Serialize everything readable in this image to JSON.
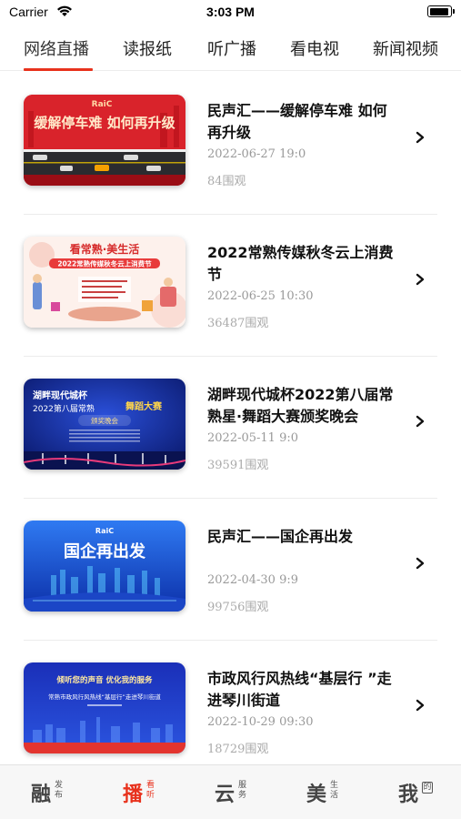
{
  "status_bar": {
    "carrier": "Carrier",
    "time": "3:03 PM"
  },
  "top_tabs": [
    {
      "label": "网络直播",
      "active": true
    },
    {
      "label": "读报纸",
      "active": false
    },
    {
      "label": "听广播",
      "active": false
    },
    {
      "label": "看电视",
      "active": false
    },
    {
      "label": "新闻视频",
      "active": false
    }
  ],
  "items": [
    {
      "title": "民声汇——缓解停车难 如何再升级",
      "date": "2022-06-27 19:0",
      "views": "84围观",
      "thumb_text": "缓解停车难  如何再升级",
      "thumb_logo": "RaiC"
    },
    {
      "title": "2022常熟传媒秋冬云上消费节",
      "date": "2022-06-25 10:30",
      "views": "36487围观",
      "thumb_text": "看常熟·美生活",
      "thumb_sub": "2022常熟传媒秋冬云上消费节"
    },
    {
      "title": "湖畔现代城杯2022第八届常熟星·舞蹈大赛颁奖晚会",
      "date": "2022-05-11 9:0",
      "views": "39591围观",
      "thumb_text": "湖畔现代城杯",
      "thumb_sub": "2022第八届常熟",
      "thumb_extra": "舞蹈大赛",
      "thumb_tag": "颁奖晚会"
    },
    {
      "title": "民声汇——国企再出发",
      "date": "2022-04-30 9:9",
      "views": "99756围观",
      "thumb_text": "国企再出发",
      "thumb_logo": "RaiC"
    },
    {
      "title": "市政风行风热线“基层行 ”走进琴川街道",
      "date": "2022-10-29 09:30",
      "views": "18729围观",
      "thumb_text": "倾听您的声音  优化我的服务",
      "thumb_sub": "常熟市政风行风热线“基层行”走进琴川街道"
    }
  ],
  "bottom_nav": [
    {
      "big": "融",
      "small": "发布",
      "active": false
    },
    {
      "big": "播",
      "small": "看听",
      "active": true
    },
    {
      "big": "云",
      "small": "服务",
      "active": false
    },
    {
      "big": "美",
      "small": "生活",
      "active": false
    },
    {
      "big": "我",
      "small": "的",
      "active": false
    }
  ],
  "colors": {
    "accent": "#e8321d"
  }
}
